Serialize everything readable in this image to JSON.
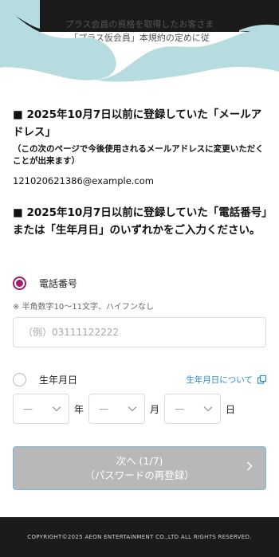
{
  "header": {
    "wave_line1": "プラス会員の資格を取得したお客さま",
    "wave_line2": "「プラス仮会員」本規約の定めに従"
  },
  "email_section": {
    "title": "■ 2025年10月7日以前に登録していた「メールアドレス」",
    "note": "（この次のページで今後使用されるメールアドレスに変更いただくことが出来ます）",
    "value": "121020621386@example.com"
  },
  "identity_section": {
    "title": "■ 2025年10月7日以前に登録していた「電話番号」または「生年月日」のいずれかをご入力ください。"
  },
  "phone_option": {
    "label": "電話番号",
    "checked": true,
    "hint": "※ 半角数字10〜11文字、ハイフンなし",
    "placeholder": "（例）03111122222"
  },
  "birth_option": {
    "label": "生年月日",
    "checked": false,
    "link_label": "生年月日について",
    "link_icon": "external-link-icon",
    "year_value": "—",
    "year_unit": "年",
    "month_value": "—",
    "month_unit": "月",
    "day_value": "—",
    "day_unit": "日"
  },
  "next_button": {
    "line1": "次へ (1/7)",
    "line2": "（パスワードの再登録）"
  },
  "footer": {
    "copyright": "COPYRIGHT©2025 AEON ENTERTAINMENT CO.,LTD ALL RIGHTS RESERVED."
  },
  "colors": {
    "accent": "#9d1f6e",
    "link": "#2a8bc7",
    "wave": "#b7dce0",
    "button_disabled": "#b8b8b8",
    "dark": "#1b1b1b"
  }
}
